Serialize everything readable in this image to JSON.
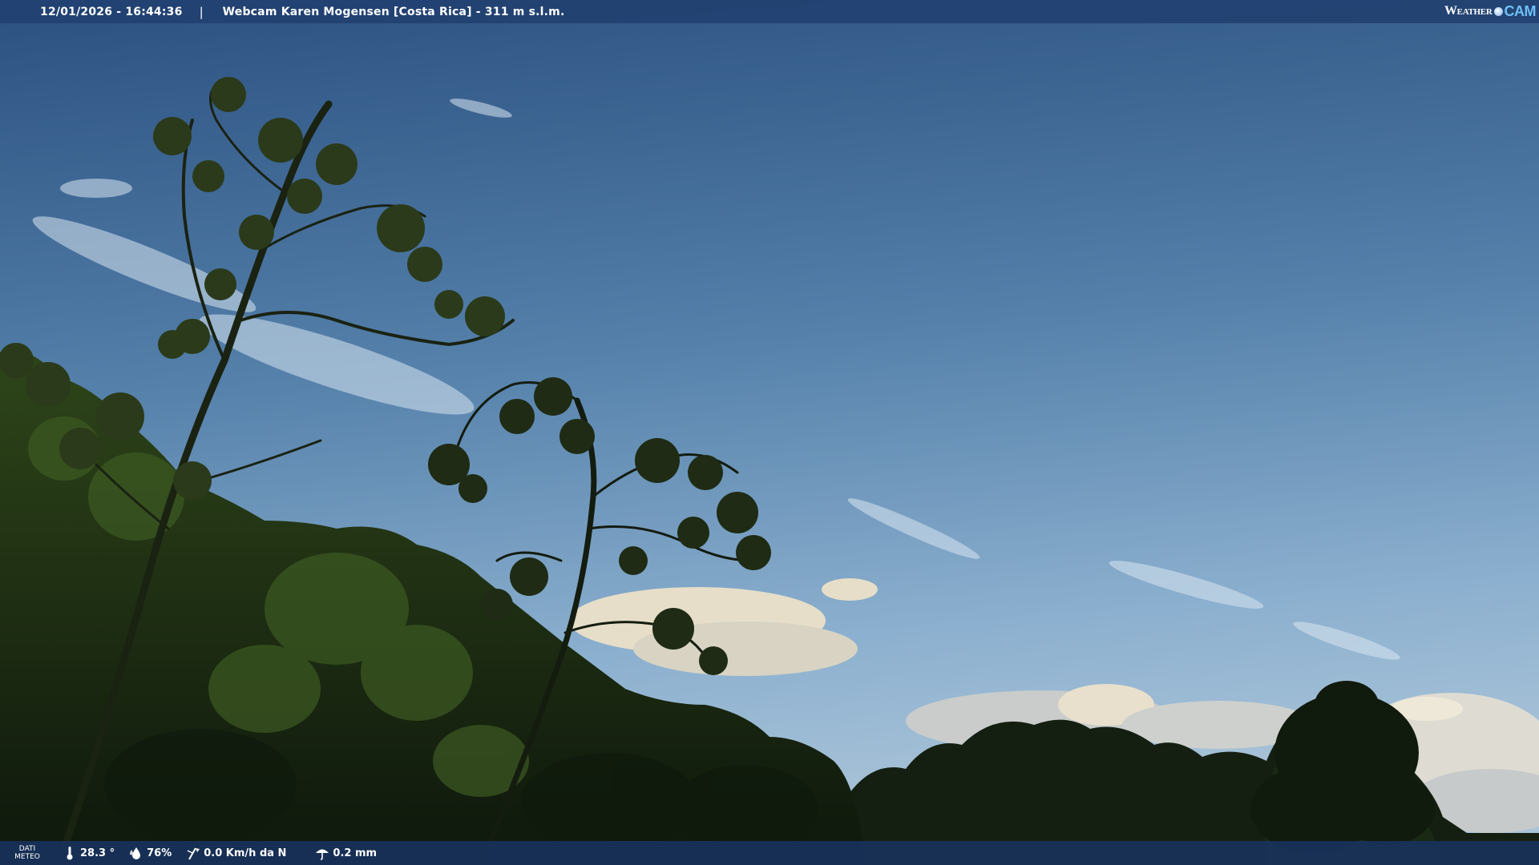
{
  "header": {
    "datetime": "12/01/2026 - 16:44:36",
    "separator": "|",
    "title": "Webcam Karen Mogensen [Costa Rica] - 311 m s.l.m."
  },
  "logo": {
    "weather": "Weather",
    "cam": "CAM"
  },
  "weather_bar": {
    "label_line1": "DATI",
    "label_line2": "METEO",
    "temperature": "28.3 °",
    "humidity": "76%",
    "wind": "0.0 Km/h da N",
    "rain": "0.2 mm"
  },
  "icons": {
    "temperature": "thermometer-icon",
    "humidity": "humidity-drop-icon",
    "wind": "wind-vane-icon",
    "rain": "umbrella-icon"
  },
  "colors": {
    "sky_top": "#2d5282",
    "sky_bottom": "#8fb3d0",
    "foliage_dark": "#101a0e",
    "foliage_lit": "#3a5220",
    "bar_blue": "#1f3f70",
    "logo_cam": "#6fc0f5"
  }
}
